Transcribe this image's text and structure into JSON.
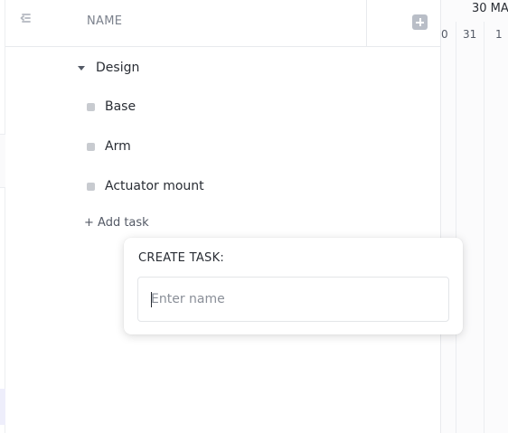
{
  "header": {
    "name_column": "NAME"
  },
  "timeline": {
    "month_label": "30 MA",
    "days": [
      "0",
      "31",
      "1"
    ]
  },
  "group": {
    "label": "Design",
    "expanded": true
  },
  "tasks": [
    {
      "label": "Base"
    },
    {
      "label": "Arm"
    },
    {
      "label": "Actuator mount"
    }
  ],
  "add_task_label": "+ Add task",
  "create_task": {
    "title": "CREATE TASK:",
    "placeholder": "Enter name",
    "value": ""
  },
  "icons": {
    "collapse": "collapse-sidebar-icon",
    "add_column": "plus-square-icon",
    "caret": "caret-down-icon",
    "status": "status-square-icon"
  },
  "colors": {
    "status_gray": "#c8cbd0",
    "icon_gray": "#b9bec7",
    "text": "#292d34"
  }
}
